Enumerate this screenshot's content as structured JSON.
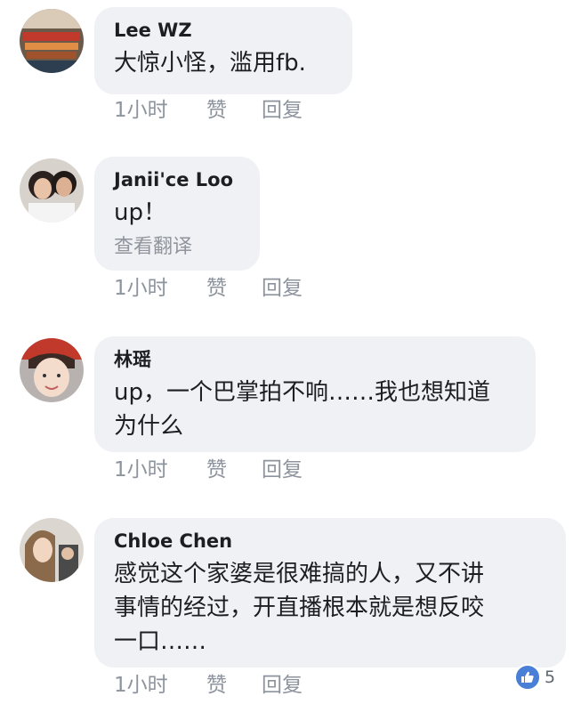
{
  "comments": [
    {
      "name": "Lee WZ",
      "text": "大惊小怪，滥用fb.",
      "time": "1小时",
      "like": "赞",
      "reply": "回复"
    },
    {
      "name": "Janii'ce Loo",
      "text": "up！",
      "translate": "查看翻译",
      "time": "1小时",
      "like": "赞",
      "reply": "回复"
    },
    {
      "name": "林瑶",
      "text_line1": "up，一个巴掌拍不响……我也想知道",
      "text_line2": "为什么",
      "time": "1小时",
      "like": "赞",
      "reply": "回复"
    },
    {
      "name": "Chloe Chen",
      "text_line1": "感觉这个家婆是很难搞的人，又不讲",
      "text_line2": "事情的经过，开直播根本就是想反咬",
      "text_line3": "一口……",
      "time": "1小时",
      "like": "赞",
      "reply": "回复",
      "reaction_icon": "thumbs-up-icon",
      "reaction_count": "5"
    }
  ],
  "colors": {
    "bubble": "#f0f1f4",
    "name": "#1c1e21",
    "meta": "#8d949e",
    "like_badge": "#4a7fd8"
  }
}
